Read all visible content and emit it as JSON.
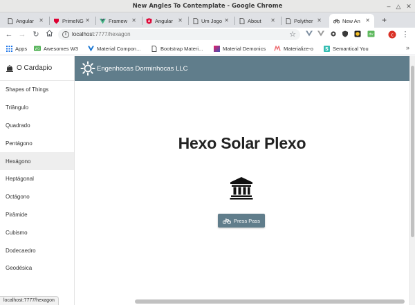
{
  "window": {
    "title": "New Angles To Contemplate - Google Chrome"
  },
  "tabs": [
    {
      "label": "Angular",
      "icon": "document-icon"
    },
    {
      "label": "PrimeNG",
      "icon": "primeng-shield-icon"
    },
    {
      "label": "Framew",
      "icon": "vue-v-icon"
    },
    {
      "label": "Angular",
      "icon": "angular-a-icon"
    },
    {
      "label": "Um Jogo",
      "icon": "document-icon"
    },
    {
      "label": "About",
      "icon": "document-icon"
    },
    {
      "label": "Polyther",
      "icon": "document-icon"
    },
    {
      "label": "New An",
      "icon": "bicycle-icon",
      "active": true
    }
  ],
  "toolbar": {
    "url_host": "localhost",
    "url_path": ":7777/hexagon"
  },
  "bookmarks": [
    {
      "label": "Apps",
      "icon": "apps-grid-icon"
    },
    {
      "label": "Awesomes W3",
      "icon": "w3-icon"
    },
    {
      "label": "Material Compon...",
      "icon": "material-v-icon"
    },
    {
      "label": "Bootstrap Materi...",
      "icon": "document-icon"
    },
    {
      "label": "Material Demonics",
      "icon": "gradient-square-icon"
    },
    {
      "label": "Materialize-o",
      "icon": "materialize-m-icon"
    },
    {
      "label": "Semantical You",
      "icon": "semantic-s-icon"
    }
  ],
  "sidebar": {
    "title": "O Cardapio",
    "items": [
      {
        "label": "Shapes of Things"
      },
      {
        "label": "Triângulo"
      },
      {
        "label": "Quadrado"
      },
      {
        "label": "Pentágono"
      },
      {
        "label": "Hexágono",
        "active": true
      },
      {
        "label": "Heptágonal"
      },
      {
        "label": "Octágono"
      },
      {
        "label": "Pirâmide"
      },
      {
        "label": "Cubismo"
      },
      {
        "label": "Dodecaedro"
      },
      {
        "label": "Geodésica"
      }
    ]
  },
  "appbar": {
    "title": "Engenhocas Dorminhocas LLC"
  },
  "content": {
    "heading": "Hexo Solar Plexo",
    "button_label": "Press Pass"
  },
  "status": {
    "url": "localhost:7777/hexagon"
  },
  "colors": {
    "primary": "#607d8b",
    "chrome_frame": "#dfe1e5"
  }
}
